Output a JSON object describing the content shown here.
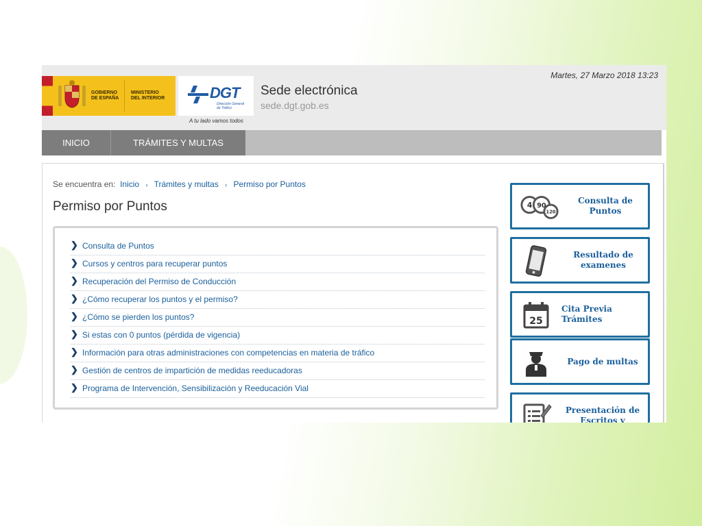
{
  "header": {
    "gov_logo": {
      "line1": "GOBIERNO",
      "line2": "DE ESPAÑA",
      "line3": "MINISTERIO",
      "line4": "DEL INTERIOR"
    },
    "dgt_logo": {
      "text": "DGT",
      "sub1": "Dirección General",
      "sub2": "de Tráfico"
    },
    "tagline": "A tu lado vamos todos",
    "site_title": "Sede electrónica",
    "site_url": "sede.dgt.gob.es",
    "datetime": "Martes, 27 Marzo 2018 13:23"
  },
  "nav": {
    "items": [
      {
        "label": "INICIO"
      },
      {
        "label": "TRÁMITES Y MULTAS"
      }
    ]
  },
  "breadcrumb": {
    "prefix": "Se encuentra en:",
    "items": [
      {
        "label": "Inicio"
      },
      {
        "label": "Trámites y multas"
      },
      {
        "label": "Permiso por Puntos"
      }
    ],
    "separator_icon": "small-chevron-right-icon"
  },
  "page": {
    "title": "Permiso por Puntos"
  },
  "links": [
    {
      "label": "Consulta de Puntos"
    },
    {
      "label": "Cursos y centros para recuperar puntos"
    },
    {
      "label": "Recuperación del Permiso de Conducción"
    },
    {
      "label": "¿Cómo recuperar los puntos y el permiso?"
    },
    {
      "label": "¿Cómo se pierden los puntos?"
    },
    {
      "label": "Si estas con 0 puntos (pérdida de vigencia)"
    },
    {
      "label": "Información para otras administraciones con competencias en materia de tráfico"
    },
    {
      "label": "Gestión de centros de impartición de medidas reeducadoras"
    },
    {
      "label": "Programa de Intervención, Sensibilización y Reeducación Vial"
    }
  ],
  "sidebar": {
    "buttons": [
      {
        "line1": "Consulta de",
        "line2": "Puntos",
        "icon": "points-speed-signs-icon",
        "icon_text1": "4",
        "icon_text2": "90",
        "icon_text3": "120"
      },
      {
        "line1": "Resultado de",
        "line2": "examenes",
        "icon": "mobile-phone-icon"
      },
      {
        "line1": "Cita Previa",
        "line2": "Trámites",
        "icon": "calendar-icon",
        "icon_text1": "25"
      },
      {
        "line1": "Pago de multas",
        "line2": "",
        "icon": "police-officer-icon"
      },
      {
        "line1": "Presentación de",
        "line2": "Escritos y",
        "icon": "document-pencil-icon"
      }
    ]
  },
  "colors": {
    "nav_active": "#7d7d7d",
    "nav_bar": "#bdbdbd",
    "link": "#1a5f9b",
    "side_border": "#1f6fa0",
    "gov_yellow": "#f4c11c",
    "dgt_blue": "#1f5aa6"
  }
}
